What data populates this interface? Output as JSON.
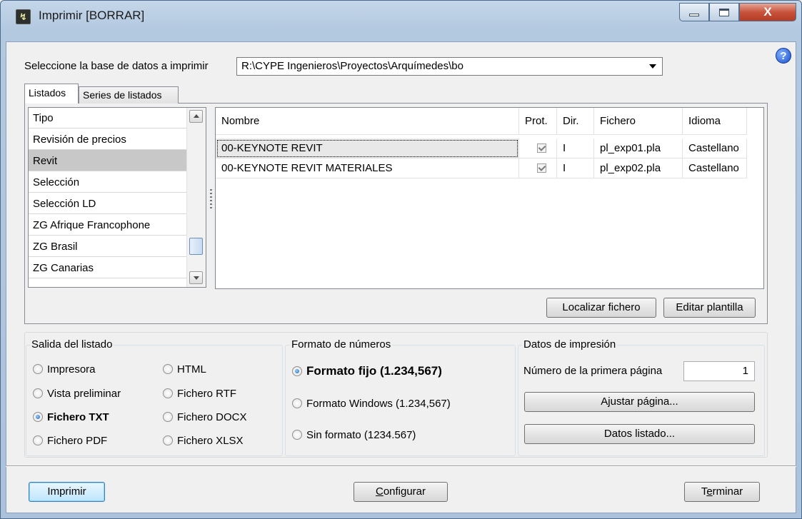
{
  "window": {
    "title": "Imprimir [BORRAR]",
    "close_glyph": "X"
  },
  "database": {
    "label": "Seleccione la base de datos a imprimir",
    "value": "R:\\CYPE Ingenieros\\Proyectos\\Arquímedes\\bo"
  },
  "tabs": [
    {
      "label": "Listados"
    },
    {
      "label": "Series de listados"
    }
  ],
  "type_list": {
    "header": "Tipo",
    "items": [
      "Revisión de precios",
      "Revit",
      "Selección",
      "Selección LD",
      "ZG Afrique Francophone",
      "ZG Brasil",
      "ZG Canarias"
    ],
    "selected": "Revit"
  },
  "table": {
    "headers": [
      "Nombre",
      "Prot.",
      "Dir.",
      "Fichero",
      "Idioma"
    ],
    "rows": [
      {
        "nombre": "00-KEYNOTE REVIT",
        "prot": true,
        "dir": "I",
        "fichero": "pl_exp01.pla",
        "idioma": "Castellano"
      },
      {
        "nombre": "00-KEYNOTE REVIT MATERIALES",
        "prot": true,
        "dir": "I",
        "fichero": "pl_exp02.pla",
        "idioma": "Castellano"
      }
    ]
  },
  "actions": {
    "locate": "Localizar fichero",
    "edit": "Editar plantilla"
  },
  "output": {
    "title": "Salida del listado",
    "options": [
      "Impresora",
      "Vista preliminar",
      "Fichero TXT",
      "Fichero PDF",
      "HTML",
      "Fichero RTF",
      "Fichero DOCX",
      "Fichero XLSX"
    ],
    "selected": "Fichero TXT"
  },
  "number_format": {
    "title": "Formato de números",
    "options": [
      "Formato fijo (1.234,567)",
      "Formato Windows (1.234,567)",
      "Sin formato (1234.567)"
    ],
    "selected": "Formato fijo (1.234,567)"
  },
  "print_data": {
    "title": "Datos de impresión",
    "first_page_label": "Número de la primera página",
    "first_page_value": "1",
    "adjust_page": "Ajustar página...",
    "list_data": "Datos listado..."
  },
  "footer": {
    "print": "Imprimir",
    "configure_first": "C",
    "configure_rest": "onfigurar",
    "finish_pre": "T",
    "finish_first": "e",
    "finish_rest": "rminar"
  }
}
